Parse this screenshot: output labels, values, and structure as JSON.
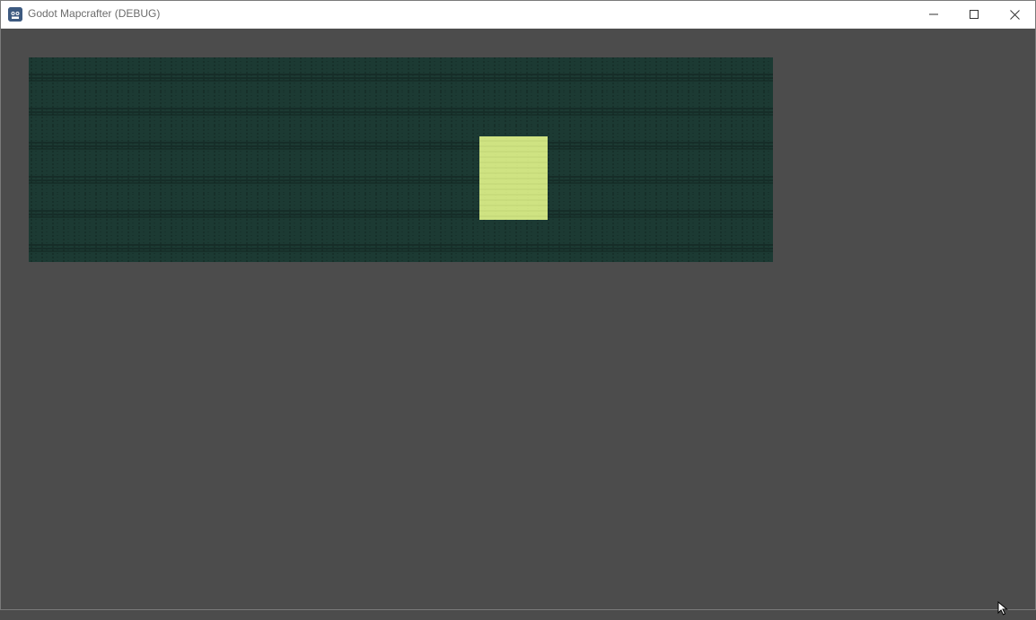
{
  "window": {
    "title": "Godot Mapcrafter (DEBUG)",
    "buttons": {
      "minimize_icon": "minimize-icon",
      "maximize_icon": "maximize-icon",
      "close_icon": "close-icon"
    }
  },
  "viewport": {
    "background_color": "#4c4c4c"
  },
  "map": {
    "tile_color": "#1c3a33",
    "line_color": "#0f201c",
    "selection_color": "#cfe382",
    "selection_line_color": "#b9cc6d"
  }
}
